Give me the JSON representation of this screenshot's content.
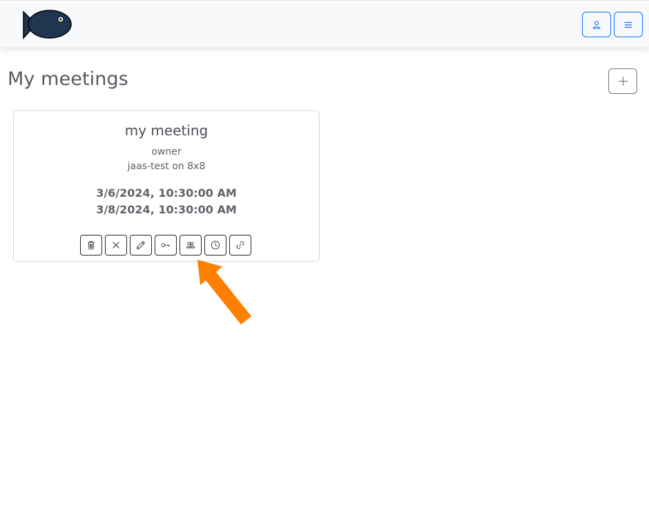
{
  "navbar": {
    "logo_icon": "fish-logo-icon",
    "user_button_icon": "person-icon",
    "menu_button_icon": "hamburger-menu-icon",
    "accent_color": "#0d6efd"
  },
  "page": {
    "title": "My meetings",
    "add_button_icon": "plus-icon"
  },
  "meeting_card": {
    "title": "my meeting",
    "role": "owner",
    "host": "jaas-test on 8x8",
    "start": "3/6/2024, 10:30:00 AM",
    "end": "3/8/2024, 10:30:00 AM",
    "actions": [
      {
        "icon": "trash-icon"
      },
      {
        "icon": "close-icon"
      },
      {
        "icon": "pencil-icon"
      },
      {
        "icon": "key-icon"
      },
      {
        "icon": "people-icon"
      },
      {
        "icon": "clock-icon"
      },
      {
        "icon": "link-icon"
      }
    ]
  },
  "annotation": {
    "arrow_color": "#ff7f00",
    "points_to": "people-icon"
  }
}
